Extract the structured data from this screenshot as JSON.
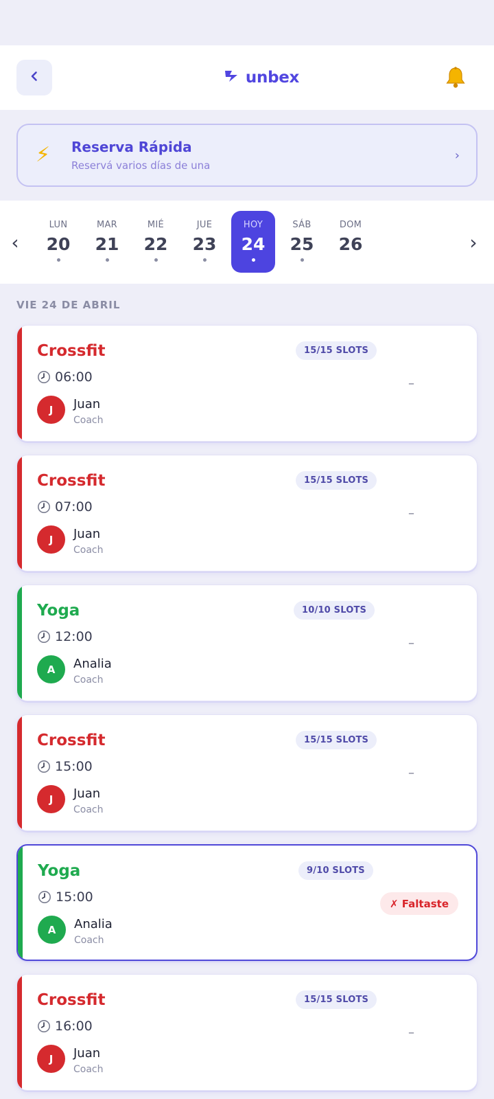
{
  "header": {
    "brand_name": "unbex"
  },
  "quick_booking": {
    "title": "Reserva Rápida",
    "subtitle": "Reservá varios días de una"
  },
  "date_strip": {
    "days": [
      {
        "name": "LUN",
        "number": "20"
      },
      {
        "name": "MAR",
        "number": "21"
      },
      {
        "name": "MIÉ",
        "number": "22"
      },
      {
        "name": "JUE",
        "number": "23"
      },
      {
        "name": "HOY",
        "number": "24"
      },
      {
        "name": "SÁB",
        "number": "25"
      },
      {
        "name": "DOM",
        "number": "26"
      }
    ]
  },
  "date_heading": "VIE 24 DE ABRIL",
  "classes": [
    {
      "name": "Crossfit",
      "slots": "15/15 SLOTS",
      "time": "06:00",
      "coach_initial": "J",
      "coach_name": "Juan",
      "coach_role": "Coach",
      "status": "–"
    },
    {
      "name": "Crossfit",
      "slots": "15/15 SLOTS",
      "time": "07:00",
      "coach_initial": "J",
      "coach_name": "Juan",
      "coach_role": "Coach",
      "status": "–"
    },
    {
      "name": "Yoga",
      "slots": "10/10 SLOTS",
      "time": "12:00",
      "coach_initial": "A",
      "coach_name": "Analia",
      "coach_role": "Coach",
      "status": "–"
    },
    {
      "name": "Crossfit",
      "slots": "15/15 SLOTS",
      "time": "15:00",
      "coach_initial": "J",
      "coach_name": "Juan",
      "coach_role": "Coach",
      "status": "–"
    },
    {
      "name": "Yoga",
      "slots": "9/10 SLOTS",
      "time": "15:00",
      "coach_initial": "A",
      "coach_name": "Analia",
      "coach_role": "Coach",
      "status": "✗ Faltaste"
    },
    {
      "name": "Crossfit",
      "slots": "15/15 SLOTS",
      "time": "16:00",
      "coach_initial": "J",
      "coach_name": "Juan",
      "coach_role": "Coach",
      "status": "–"
    }
  ],
  "colors": {
    "crossfit": "#d52a2e",
    "yoga": "#1faa4f",
    "accent": "#4d44e0",
    "missed": "#d9252b"
  }
}
